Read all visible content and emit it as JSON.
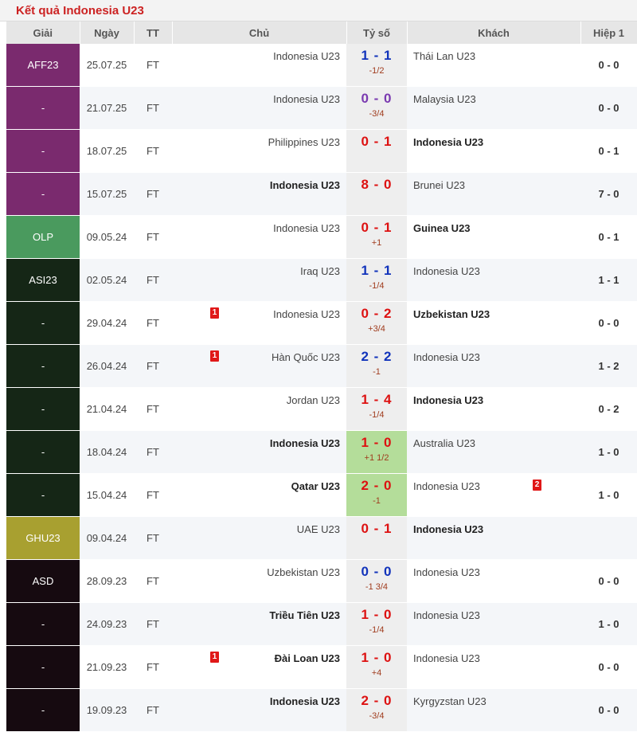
{
  "title": "Kết quả Indonesia U23",
  "headers": [
    "Giải",
    "Ngày",
    "TT",
    "Chủ",
    "Tỷ số",
    "Khách",
    "Hiệp 1"
  ],
  "colors": {
    "win": "#dd1111",
    "draw": "#1133bb",
    "score_zero_zero": "#7a3ab0",
    "highlight": "#b4dd9a"
  },
  "matches": [
    {
      "league": "AFF23",
      "league_color": "#7a2a6e",
      "date": "25.07.25",
      "status": "FT",
      "home": "Indonesia U23",
      "home_bold": false,
      "score": "1 - 1",
      "score_color": "#1133bb",
      "handicap": "-1/2",
      "away": "Thái Lan U23",
      "away_bold": false,
      "half": "0 - 0",
      "home_card": "",
      "away_card": "",
      "highlight": false
    },
    {
      "league": "-",
      "league_color": "#7a2a6e",
      "date": "21.07.25",
      "status": "FT",
      "home": "Indonesia U23",
      "home_bold": false,
      "score": "0 - 0",
      "score_color": "#7a3ab0",
      "handicap": "-3/4",
      "away": "Malaysia U23",
      "away_bold": false,
      "half": "0 - 0",
      "home_card": "",
      "away_card": "",
      "highlight": false
    },
    {
      "league": "-",
      "league_color": "#7a2a6e",
      "date": "18.07.25",
      "status": "FT",
      "home": "Philippines U23",
      "home_bold": false,
      "score": "0 - 1",
      "score_color": "#dd1111",
      "handicap": "",
      "away": "Indonesia U23",
      "away_bold": true,
      "half": "0 - 1",
      "home_card": "",
      "away_card": "",
      "highlight": false
    },
    {
      "league": "-",
      "league_color": "#7a2a6e",
      "date": "15.07.25",
      "status": "FT",
      "home": "Indonesia U23",
      "home_bold": true,
      "score": "8 - 0",
      "score_color": "#dd1111",
      "handicap": "",
      "away": "Brunei U23",
      "away_bold": false,
      "half": "7 - 0",
      "home_card": "",
      "away_card": "",
      "highlight": false
    },
    {
      "league": "OLP",
      "league_color": "#4a9a5e",
      "date": "09.05.24",
      "status": "FT",
      "home": "Indonesia U23",
      "home_bold": false,
      "score": "0 - 1",
      "score_color": "#dd1111",
      "handicap": "+1",
      "away": "Guinea U23",
      "away_bold": true,
      "half": "0 - 1",
      "home_card": "",
      "away_card": "",
      "highlight": false
    },
    {
      "league": "ASI23",
      "league_color": "#152616",
      "date": "02.05.24",
      "status": "FT",
      "home": "Iraq U23",
      "home_bold": false,
      "score": "1 - 1",
      "score_color": "#1133bb",
      "handicap": "-1/4",
      "away": "Indonesia U23",
      "away_bold": false,
      "half": "1 - 1",
      "home_card": "",
      "away_card": "",
      "highlight": false
    },
    {
      "league": "-",
      "league_color": "#152616",
      "date": "29.04.24",
      "status": "FT",
      "home": "Indonesia U23",
      "home_bold": false,
      "score": "0 - 2",
      "score_color": "#dd1111",
      "handicap": "+3/4",
      "away": "Uzbekistan U23",
      "away_bold": true,
      "half": "0 - 0",
      "home_card": "1",
      "away_card": "",
      "highlight": false
    },
    {
      "league": "-",
      "league_color": "#152616",
      "date": "26.04.24",
      "status": "FT",
      "home": "Hàn Quốc U23",
      "home_bold": false,
      "score": "2 - 2",
      "score_color": "#1133bb",
      "handicap": "-1",
      "away": "Indonesia U23",
      "away_bold": false,
      "half": "1 - 2",
      "home_card": "1",
      "away_card": "",
      "highlight": false
    },
    {
      "league": "-",
      "league_color": "#152616",
      "date": "21.04.24",
      "status": "FT",
      "home": "Jordan U23",
      "home_bold": false,
      "score": "1 - 4",
      "score_color": "#dd1111",
      "handicap": "-1/4",
      "away": "Indonesia U23",
      "away_bold": true,
      "half": "0 - 2",
      "home_card": "",
      "away_card": "",
      "highlight": false
    },
    {
      "league": "-",
      "league_color": "#152616",
      "date": "18.04.24",
      "status": "FT",
      "home": "Indonesia U23",
      "home_bold": true,
      "score": "1 - 0",
      "score_color": "#dd1111",
      "handicap": "+1 1/2",
      "away": "Australia U23",
      "away_bold": false,
      "half": "1 - 0",
      "home_card": "",
      "away_card": "",
      "highlight": true
    },
    {
      "league": "-",
      "league_color": "#152616",
      "date": "15.04.24",
      "status": "FT",
      "home": "Qatar U23",
      "home_bold": true,
      "score": "2 - 0",
      "score_color": "#dd1111",
      "handicap": "-1",
      "away": "Indonesia U23",
      "away_bold": false,
      "half": "1 - 0",
      "home_card": "",
      "away_card": "2",
      "highlight": true
    },
    {
      "league": "GHU23",
      "league_color": "#a8a030",
      "date": "09.04.24",
      "status": "FT",
      "home": "UAE U23",
      "home_bold": false,
      "score": "0 - 1",
      "score_color": "#dd1111",
      "handicap": "",
      "away": "Indonesia U23",
      "away_bold": true,
      "half": "",
      "home_card": "",
      "away_card": "",
      "highlight": false
    },
    {
      "league": "ASD",
      "league_color": "#160a10",
      "date": "28.09.23",
      "status": "FT",
      "home": "Uzbekistan U23",
      "home_bold": false,
      "score": "0 - 0",
      "score_color": "#1133bb",
      "handicap": "-1 3/4",
      "away": "Indonesia U23",
      "away_bold": false,
      "half": "0 - 0",
      "home_card": "",
      "away_card": "",
      "highlight": false
    },
    {
      "league": "-",
      "league_color": "#160a10",
      "date": "24.09.23",
      "status": "FT",
      "home": "Triều Tiên U23",
      "home_bold": true,
      "score": "1 - 0",
      "score_color": "#dd1111",
      "handicap": "-1/4",
      "away": "Indonesia U23",
      "away_bold": false,
      "half": "1 - 0",
      "home_card": "",
      "away_card": "",
      "highlight": false
    },
    {
      "league": "-",
      "league_color": "#160a10",
      "date": "21.09.23",
      "status": "FT",
      "home": "Đài Loan U23",
      "home_bold": true,
      "score": "1 - 0",
      "score_color": "#dd1111",
      "handicap": "+4",
      "away": "Indonesia U23",
      "away_bold": false,
      "half": "0 - 0",
      "home_card": "1",
      "away_card": "",
      "highlight": false
    },
    {
      "league": "-",
      "league_color": "#160a10",
      "date": "19.09.23",
      "status": "FT",
      "home": "Indonesia U23",
      "home_bold": true,
      "score": "2 - 0",
      "score_color": "#dd1111",
      "handicap": "-3/4",
      "away": "Kyrgyzstan U23",
      "away_bold": false,
      "half": "0 - 0",
      "home_card": "",
      "away_card": "",
      "highlight": false
    }
  ]
}
